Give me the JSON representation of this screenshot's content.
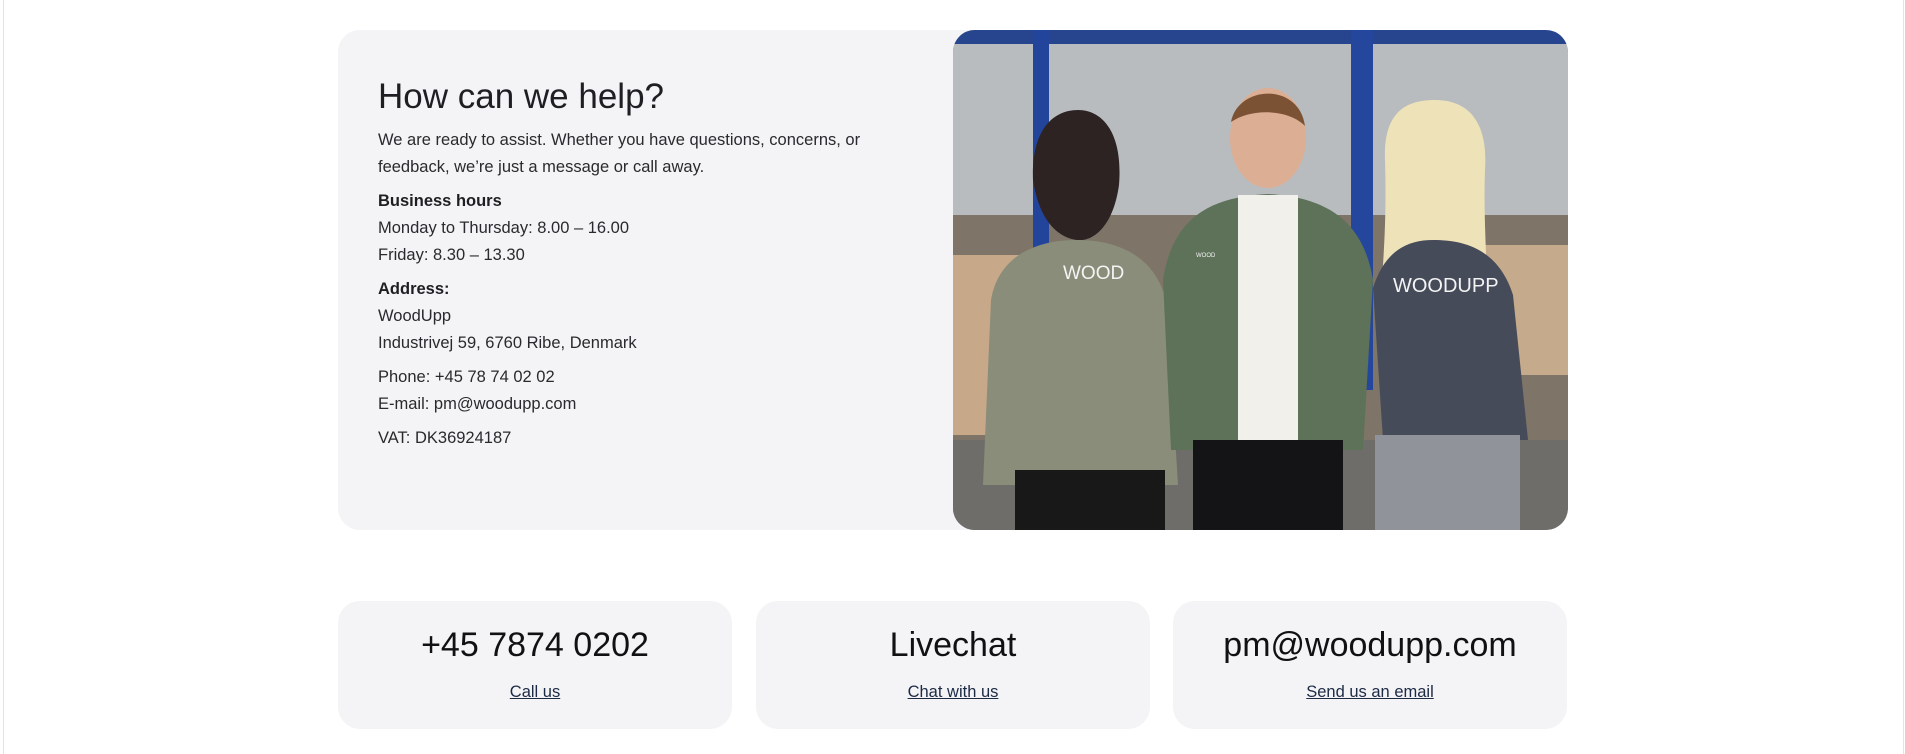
{
  "help": {
    "title": "How can we help?",
    "intro": "We are ready to assist. Whether you have questions, concerns, or feedback, we’re just a message or call away.",
    "hours_label": "Business hours",
    "hours": [
      "Monday to Thursday: 8.00 – 16.00",
      "Friday: 8.30 – 13.30"
    ],
    "address_label": "Address:",
    "address": [
      "WoodUpp",
      "Industrivej 59, 6760 Ribe, Denmark"
    ],
    "phone": "Phone: +45 78 74 02 02",
    "email": "E-mail: pm@woodupp.com",
    "vat": "VAT: DK36924187"
  },
  "photo": {
    "shirt_text": [
      "WOOD",
      "WOOD",
      "WOODUPP"
    ]
  },
  "contact_cards": [
    {
      "title": "+45 7874 0202",
      "link": "Call us"
    },
    {
      "title": "Livechat",
      "link": "Chat with us"
    },
    {
      "title": "pm@woodupp.com",
      "link": "Send us an email"
    }
  ],
  "colors": {
    "card_background": "#f4f4f6",
    "text": "#1f1f23",
    "link": "#1c2a44"
  }
}
